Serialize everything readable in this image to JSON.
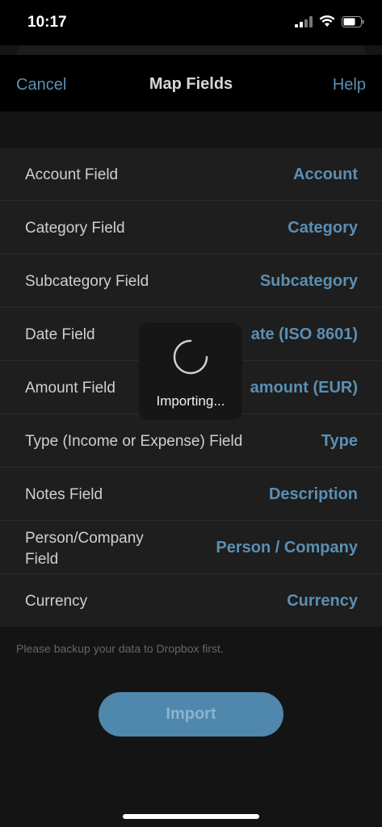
{
  "status": {
    "time": "10:17"
  },
  "nav": {
    "cancel": "Cancel",
    "title": "Map Fields",
    "help": "Help"
  },
  "fields": [
    {
      "label": "Account Field",
      "value": "Account"
    },
    {
      "label": "Category Field",
      "value": "Category"
    },
    {
      "label": "Subcategory Field",
      "value": "Subcategory"
    },
    {
      "label": "Date Field",
      "value": "ate (ISO 8601)"
    },
    {
      "label": "Amount Field",
      "value": "amount (EUR)"
    },
    {
      "label": "Type (Income or Expense) Field",
      "value": "Type"
    },
    {
      "label": "Notes Field",
      "value": "Description"
    },
    {
      "label": "Person/Company Field",
      "value": "Person / Company"
    },
    {
      "label": "Currency",
      "value": "Currency"
    }
  ],
  "footnote": "Please backup your data to Dropbox first.",
  "import_label": "Import",
  "hud": {
    "label": "Importing..."
  },
  "colors": {
    "accent": "#5b8fb4",
    "button": "#4f87ad",
    "background": "#141414",
    "row": "#1e1e1e"
  }
}
